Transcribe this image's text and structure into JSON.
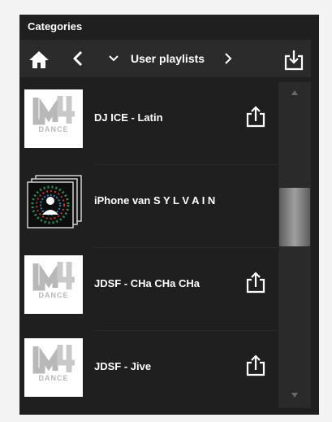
{
  "panel": {
    "title": "Categories"
  },
  "toolbar": {
    "icons": [
      "home-icon",
      "back-icon",
      "chevron-down-icon",
      "forward-icon",
      "import-icon"
    ],
    "label": "User playlists"
  },
  "playlists": [
    {
      "name": "DJ ICE - Latin",
      "thumb": "m4-dance-logo",
      "thumb_text": "DANCE",
      "shareable": true
    },
    {
      "name": "iPhone van S Y L V A I N",
      "thumb": "device-avatar",
      "shareable": false
    },
    {
      "name": "JDSF - CHa CHa CHa",
      "thumb": "m4-dance-logo",
      "thumb_text": "DANCE",
      "shareable": true
    },
    {
      "name": "JDSF - Jive",
      "thumb": "m4-dance-logo",
      "thumb_text": "DANCE",
      "shareable": true
    }
  ],
  "colors": {
    "panel_bg": "#1f1f1f",
    "toolbar_bg": "#2b2b2b",
    "text": "#ffffff"
  }
}
